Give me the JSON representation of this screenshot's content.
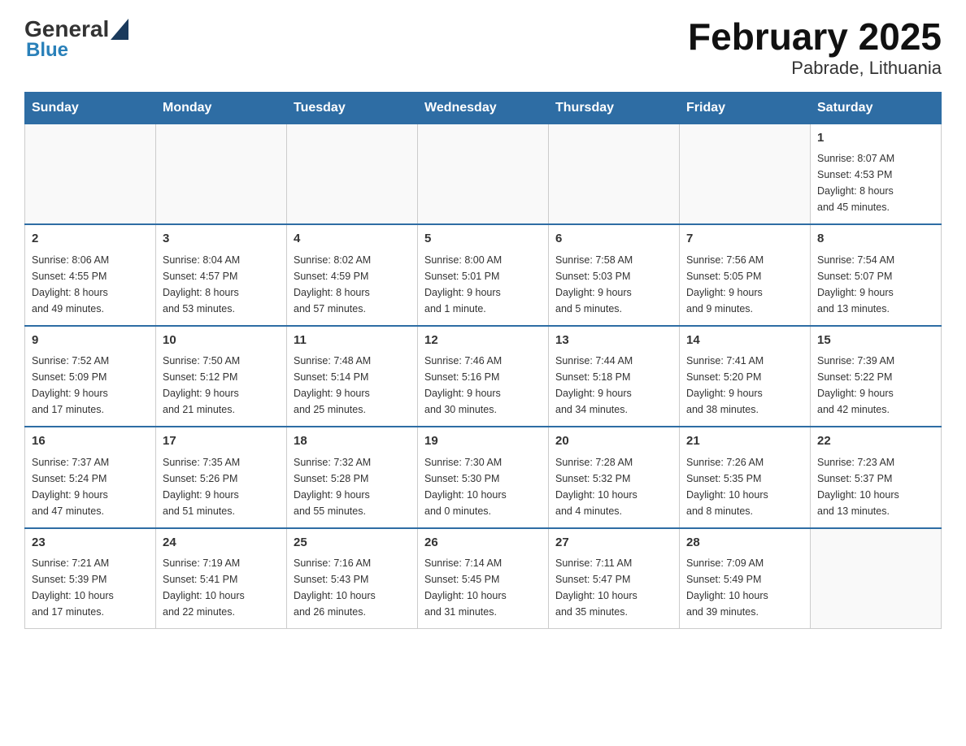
{
  "header": {
    "logo_general": "General",
    "logo_blue": "Blue",
    "title": "February 2025",
    "subtitle": "Pabrade, Lithuania"
  },
  "days_of_week": [
    "Sunday",
    "Monday",
    "Tuesday",
    "Wednesday",
    "Thursday",
    "Friday",
    "Saturday"
  ],
  "weeks": [
    [
      {
        "day": "",
        "info": ""
      },
      {
        "day": "",
        "info": ""
      },
      {
        "day": "",
        "info": ""
      },
      {
        "day": "",
        "info": ""
      },
      {
        "day": "",
        "info": ""
      },
      {
        "day": "",
        "info": ""
      },
      {
        "day": "1",
        "info": "Sunrise: 8:07 AM\nSunset: 4:53 PM\nDaylight: 8 hours\nand 45 minutes."
      }
    ],
    [
      {
        "day": "2",
        "info": "Sunrise: 8:06 AM\nSunset: 4:55 PM\nDaylight: 8 hours\nand 49 minutes."
      },
      {
        "day": "3",
        "info": "Sunrise: 8:04 AM\nSunset: 4:57 PM\nDaylight: 8 hours\nand 53 minutes."
      },
      {
        "day": "4",
        "info": "Sunrise: 8:02 AM\nSunset: 4:59 PM\nDaylight: 8 hours\nand 57 minutes."
      },
      {
        "day": "5",
        "info": "Sunrise: 8:00 AM\nSunset: 5:01 PM\nDaylight: 9 hours\nand 1 minute."
      },
      {
        "day": "6",
        "info": "Sunrise: 7:58 AM\nSunset: 5:03 PM\nDaylight: 9 hours\nand 5 minutes."
      },
      {
        "day": "7",
        "info": "Sunrise: 7:56 AM\nSunset: 5:05 PM\nDaylight: 9 hours\nand 9 minutes."
      },
      {
        "day": "8",
        "info": "Sunrise: 7:54 AM\nSunset: 5:07 PM\nDaylight: 9 hours\nand 13 minutes."
      }
    ],
    [
      {
        "day": "9",
        "info": "Sunrise: 7:52 AM\nSunset: 5:09 PM\nDaylight: 9 hours\nand 17 minutes."
      },
      {
        "day": "10",
        "info": "Sunrise: 7:50 AM\nSunset: 5:12 PM\nDaylight: 9 hours\nand 21 minutes."
      },
      {
        "day": "11",
        "info": "Sunrise: 7:48 AM\nSunset: 5:14 PM\nDaylight: 9 hours\nand 25 minutes."
      },
      {
        "day": "12",
        "info": "Sunrise: 7:46 AM\nSunset: 5:16 PM\nDaylight: 9 hours\nand 30 minutes."
      },
      {
        "day": "13",
        "info": "Sunrise: 7:44 AM\nSunset: 5:18 PM\nDaylight: 9 hours\nand 34 minutes."
      },
      {
        "day": "14",
        "info": "Sunrise: 7:41 AM\nSunset: 5:20 PM\nDaylight: 9 hours\nand 38 minutes."
      },
      {
        "day": "15",
        "info": "Sunrise: 7:39 AM\nSunset: 5:22 PM\nDaylight: 9 hours\nand 42 minutes."
      }
    ],
    [
      {
        "day": "16",
        "info": "Sunrise: 7:37 AM\nSunset: 5:24 PM\nDaylight: 9 hours\nand 47 minutes."
      },
      {
        "day": "17",
        "info": "Sunrise: 7:35 AM\nSunset: 5:26 PM\nDaylight: 9 hours\nand 51 minutes."
      },
      {
        "day": "18",
        "info": "Sunrise: 7:32 AM\nSunset: 5:28 PM\nDaylight: 9 hours\nand 55 minutes."
      },
      {
        "day": "19",
        "info": "Sunrise: 7:30 AM\nSunset: 5:30 PM\nDaylight: 10 hours\nand 0 minutes."
      },
      {
        "day": "20",
        "info": "Sunrise: 7:28 AM\nSunset: 5:32 PM\nDaylight: 10 hours\nand 4 minutes."
      },
      {
        "day": "21",
        "info": "Sunrise: 7:26 AM\nSunset: 5:35 PM\nDaylight: 10 hours\nand 8 minutes."
      },
      {
        "day": "22",
        "info": "Sunrise: 7:23 AM\nSunset: 5:37 PM\nDaylight: 10 hours\nand 13 minutes."
      }
    ],
    [
      {
        "day": "23",
        "info": "Sunrise: 7:21 AM\nSunset: 5:39 PM\nDaylight: 10 hours\nand 17 minutes."
      },
      {
        "day": "24",
        "info": "Sunrise: 7:19 AM\nSunset: 5:41 PM\nDaylight: 10 hours\nand 22 minutes."
      },
      {
        "day": "25",
        "info": "Sunrise: 7:16 AM\nSunset: 5:43 PM\nDaylight: 10 hours\nand 26 minutes."
      },
      {
        "day": "26",
        "info": "Sunrise: 7:14 AM\nSunset: 5:45 PM\nDaylight: 10 hours\nand 31 minutes."
      },
      {
        "day": "27",
        "info": "Sunrise: 7:11 AM\nSunset: 5:47 PM\nDaylight: 10 hours\nand 35 minutes."
      },
      {
        "day": "28",
        "info": "Sunrise: 7:09 AM\nSunset: 5:49 PM\nDaylight: 10 hours\nand 39 minutes."
      },
      {
        "day": "",
        "info": ""
      }
    ]
  ]
}
